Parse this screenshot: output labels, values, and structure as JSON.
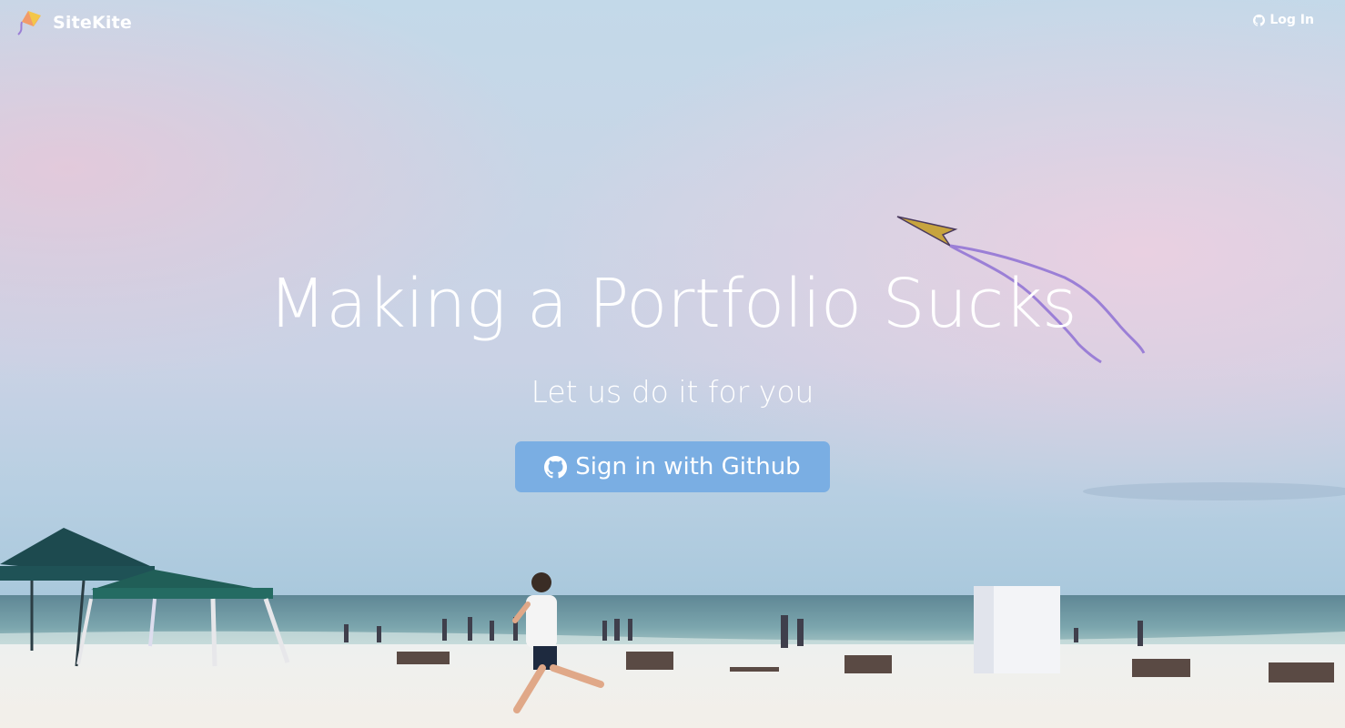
{
  "nav": {
    "brand_name": "SiteKite",
    "brand_icon": "kite-logo-icon",
    "login_label": "Log In",
    "login_icon": "github-icon"
  },
  "hero": {
    "title": "Making a Portfolio Sucks",
    "subtitle": "Let us do it for you",
    "cta_label": "Sign in with Github",
    "cta_icon": "github-icon"
  },
  "colors": {
    "cta_background": "#7aaee3",
    "text": "#ffffff",
    "sky_top": "#c4d9e8",
    "sky_pink": "#e5cfe0",
    "ocean": "#6f9aa8",
    "sand": "#f1eeea",
    "kite_tail": "#9b7fd6"
  }
}
